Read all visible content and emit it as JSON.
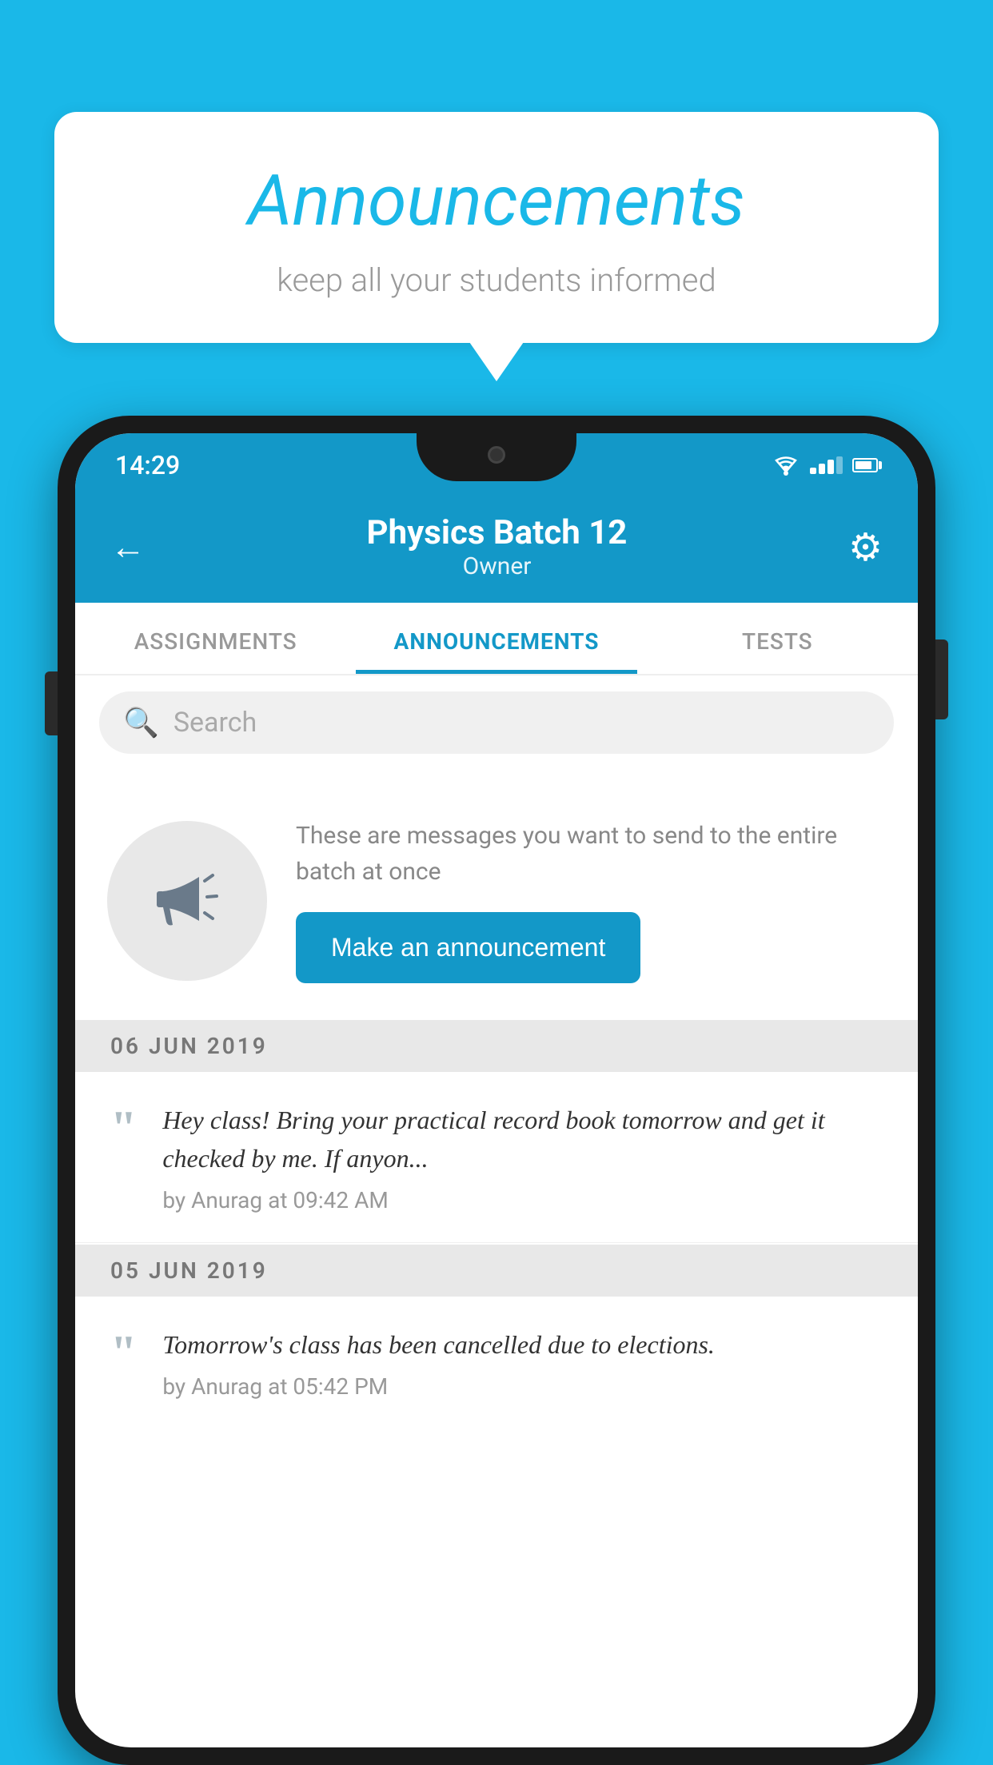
{
  "background_color": "#1ab8e8",
  "bubble": {
    "title": "Announcements",
    "subtitle": "keep all your students informed"
  },
  "phone": {
    "status_bar": {
      "time": "14:29"
    },
    "header": {
      "title": "Physics Batch 12",
      "subtitle": "Owner",
      "back_label": "←",
      "gear_label": "⚙"
    },
    "tabs": [
      {
        "label": "ASSIGNMENTS",
        "active": false
      },
      {
        "label": "ANNOUNCEMENTS",
        "active": true
      },
      {
        "label": "TESTS",
        "active": false
      }
    ],
    "search": {
      "placeholder": "Search"
    },
    "cta": {
      "description": "These are messages you want to send to the entire batch at once",
      "button_label": "Make an announcement"
    },
    "announcements": [
      {
        "date": "06  JUN  2019",
        "text": "Hey class! Bring your practical record book tomorrow and get it checked by me. If anyon...",
        "meta": "by Anurag at 09:42 AM"
      },
      {
        "date": "05  JUN  2019",
        "text": "Tomorrow's class has been cancelled due to elections.",
        "meta": "by Anurag at 05:42 PM"
      }
    ]
  }
}
